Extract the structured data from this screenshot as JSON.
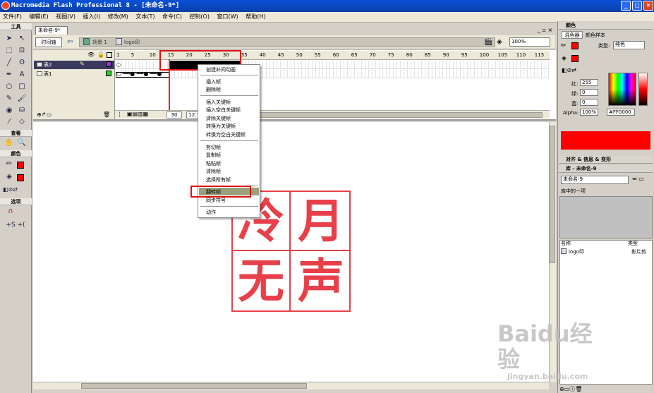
{
  "window": {
    "title": "Macromedia Flash Professional 8 - [未命名-9*]",
    "buttons": [
      "_",
      "□",
      "×"
    ]
  },
  "menubar": [
    "文件(F)",
    "编辑(E)",
    "视图(V)",
    "插入(I)",
    "修改(M)",
    "文本(T)",
    "命令(C)",
    "控制(O)",
    "窗口(W)",
    "帮助(H)"
  ],
  "tools": {
    "header": "工具",
    "view_header": "查看",
    "color_header": "颜色",
    "options_header": "选项"
  },
  "document": {
    "tab": "未命名-9*",
    "timeline_button": "时间轴",
    "breadcrumb_scene": "场景 1",
    "breadcrumb_symbol": "logo印",
    "zoom": "100%",
    "frame_numbers": [
      "1",
      "5",
      "10",
      "15",
      "20",
      "25",
      "30",
      "35",
      "40",
      "45",
      "50",
      "55",
      "60",
      "65",
      "70",
      "75",
      "80",
      "85",
      "90",
      "95",
      "100",
      "105",
      "110",
      "115"
    ],
    "layers": [
      {
        "name": "表2",
        "selected": true
      },
      {
        "name": "表1",
        "selected": false
      }
    ],
    "current_frame": "30",
    "fps": "12.",
    "stamp_chars": [
      "冷",
      "月",
      "无",
      "声"
    ]
  },
  "context_menu": {
    "items": [
      "创建补间动画",
      "插入帧",
      "删除帧",
      "插入关键帧",
      "插入空白关键帧",
      "清除关键帧",
      "转换为关键帧",
      "转换为空白关键帧",
      "剪切帧",
      "复制帧",
      "粘贴帧",
      "清除帧",
      "选择所有帧",
      "翻转帧",
      "同步符号",
      "动作"
    ],
    "highlighted": "翻转帧"
  },
  "color_panel": {
    "header": "颜色",
    "tabs": [
      "混色器",
      "颜色样本"
    ],
    "type_label": "类型:",
    "type_value": "纯色",
    "red_label": "红:",
    "red_value": "255",
    "green_label": "绿:",
    "green_value": "0",
    "blue_label": "蓝:",
    "blue_value": "0",
    "alpha_label": "Alpha:",
    "alpha_value": "100%",
    "hex": "#FF0000",
    "current_color": "#ff0000"
  },
  "align_panel": {
    "header": "对齐 & 信息 & 变形"
  },
  "library_panel": {
    "header": "库 - 未命名-9",
    "select_value": "未命名-9",
    "item_count": "库中的一项",
    "col_name": "名称",
    "col_type": "类型",
    "item_name": "logo印",
    "item_type": "影片剪"
  },
  "watermark": {
    "brand": "Baidu经验",
    "url": "jingyan.baidu.com"
  }
}
